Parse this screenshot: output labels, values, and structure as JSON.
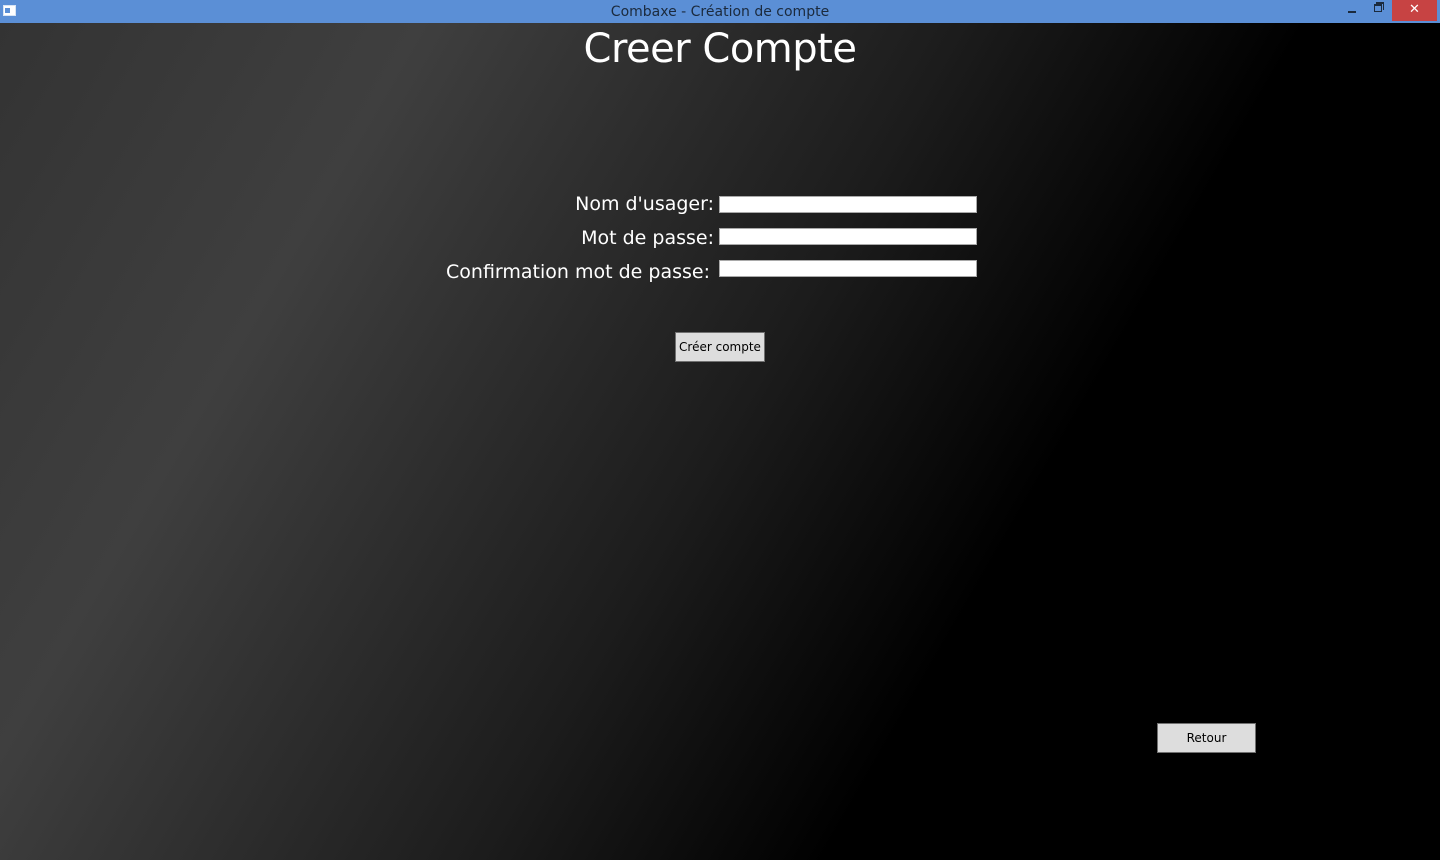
{
  "window": {
    "title": "Combaxe - Création de compte",
    "controls": {
      "minimize_icon": "minimize-icon",
      "maximize_icon": "restore-icon",
      "close_glyph": "✕"
    },
    "titlebar_color": "#5b8fd6",
    "close_color": "#c74343"
  },
  "page": {
    "heading": "Creer Compte"
  },
  "form": {
    "username_label": "Nom d'usager:",
    "username_value": "",
    "password_label": "Mot de passe:",
    "password_value": "",
    "confirm_label": "Confirmation mot de passe:",
    "confirm_value": "",
    "create_button": "Créer compte"
  },
  "footer": {
    "back_button": "Retour"
  }
}
